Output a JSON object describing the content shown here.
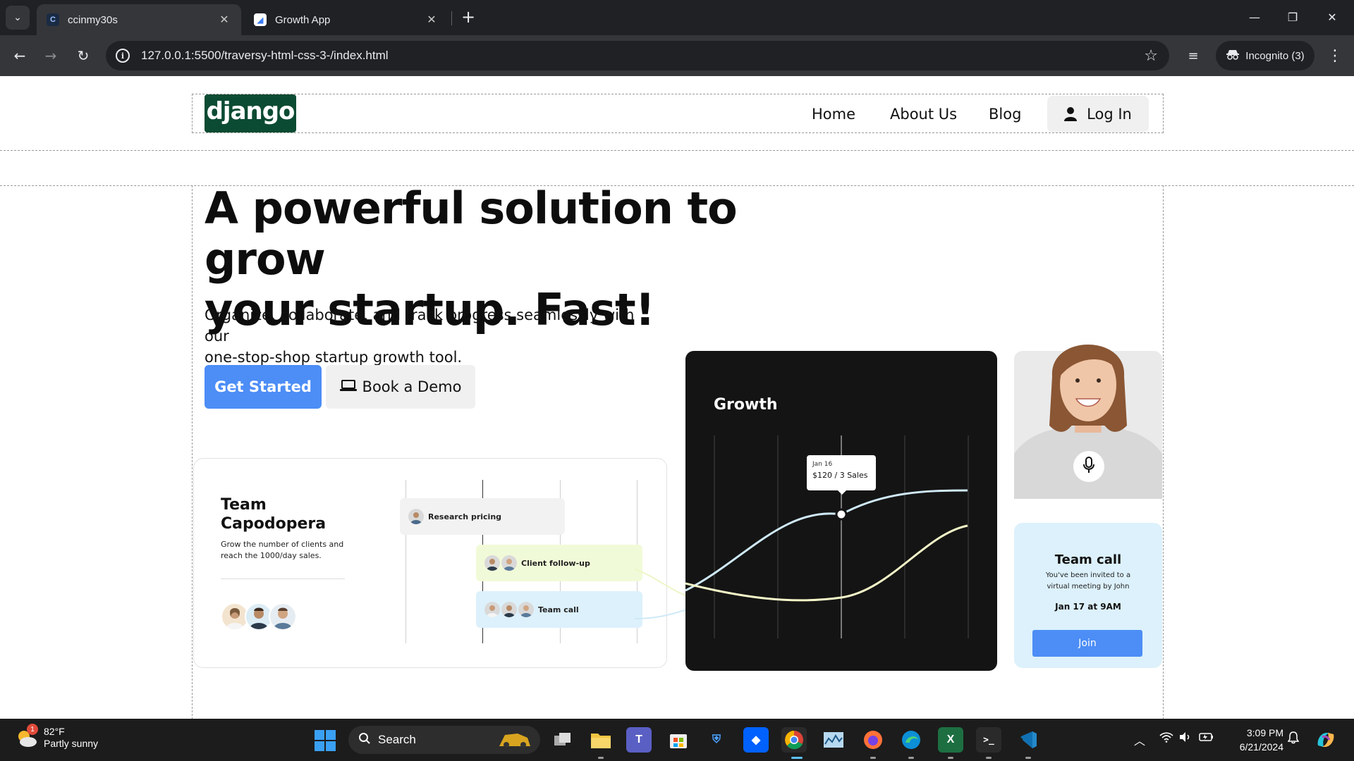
{
  "browser": {
    "tabs": [
      {
        "title": "ccinmy30s",
        "favicon": "C",
        "active": true
      },
      {
        "title": "Growth App",
        "active": false
      }
    ],
    "url": "127.0.0.1:5500/traversy-html-css-3-/index.html",
    "incognito_label": "Incognito (3)"
  },
  "site": {
    "logo_text": "django",
    "nav": [
      "Home",
      "About Us",
      "Blog"
    ],
    "login_label": "Log In",
    "hero": {
      "title_line1": "A powerful solution to grow",
      "title_line2": "your startup. Fast!",
      "subtitle_line1": "Organize, collaborate, and track progress seamlessly with our",
      "subtitle_line2": "one-stop-shop startup growth tool.",
      "primary_cta": "Get Started",
      "secondary_cta": "Book a Demo"
    },
    "team_card": {
      "name_line1": "Team",
      "name_line2": "Capodopera",
      "desc_line1": "Grow the number of clients and",
      "desc_line2": "reach the 1000/day sales.",
      "tasks": [
        "Research pricing",
        "Client follow-up",
        "Team call"
      ]
    },
    "growth_card": {
      "title": "Growth",
      "tooltip_date": "Jan 16",
      "tooltip_value": "$120 / 3 Sales"
    },
    "call_card": {
      "title": "Team call",
      "desc_line1": "You've been invited to a",
      "desc_line2": "virtual meeting by John",
      "date": "Jan 17 at 9AM",
      "join_label": "Join"
    }
  },
  "taskbar": {
    "weather_temp": "82°F",
    "weather_desc": "Partly sunny",
    "weather_badge": "1",
    "search_label": "Search",
    "time": "3:09 PM",
    "date": "6/21/2024"
  },
  "colors": {
    "accent_blue": "#4c8df6",
    "django_green": "#0c4b33",
    "growth_bg": "#141414",
    "call_bg": "#dcf1fb"
  }
}
